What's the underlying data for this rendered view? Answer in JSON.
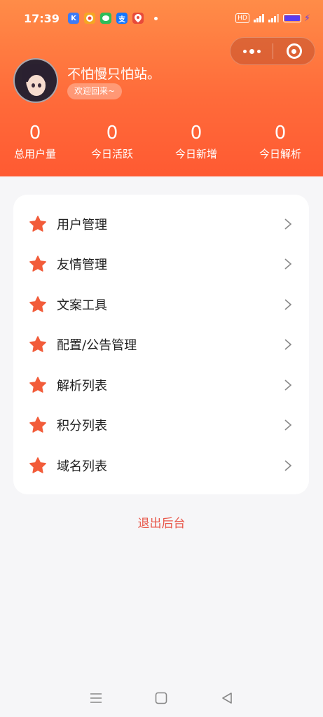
{
  "status_bar": {
    "time": "17:39",
    "app_icons": [
      {
        "name": "k-app-icon",
        "glyph": "K",
        "color": "#3d7bf5"
      },
      {
        "name": "weibo-icon",
        "glyph": "微",
        "color": "#f5a623"
      },
      {
        "name": "wechat-icon",
        "glyph": "微",
        "color": "#2ebd59"
      },
      {
        "name": "alipay-icon",
        "glyph": "支",
        "color": "#1677ff"
      },
      {
        "name": "location-app-icon",
        "glyph": "⌖",
        "color": "#e84a3a"
      }
    ],
    "hd": "HD",
    "signal1": "4G",
    "signal2": "4G"
  },
  "user": {
    "name": "不怕慢只怕站。",
    "welcome": "欢迎回来~"
  },
  "stats": [
    {
      "value": "0",
      "label": "总用户量"
    },
    {
      "value": "0",
      "label": "今日活跃"
    },
    {
      "value": "0",
      "label": "今日新增"
    },
    {
      "value": "0",
      "label": "今日解析"
    }
  ],
  "menu": [
    {
      "label": "用户管理"
    },
    {
      "label": "友情管理"
    },
    {
      "label": "文案工具"
    },
    {
      "label": "配置/公告管理"
    },
    {
      "label": "解析列表"
    },
    {
      "label": "积分列表"
    },
    {
      "label": "域名列表"
    }
  ],
  "logout_label": "退出后台",
  "colors": {
    "accent": "#ff5a32",
    "star": "#f25c3a",
    "logout": "#e8574a"
  }
}
